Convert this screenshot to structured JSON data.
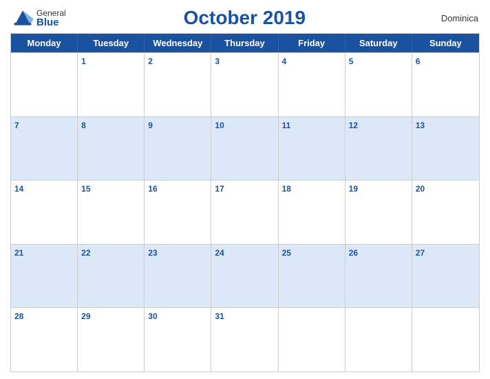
{
  "logo": {
    "general": "General",
    "blue": "Blue",
    "icon_color": "#1a52a0"
  },
  "header": {
    "title": "October 2019",
    "country": "Dominica"
  },
  "days_header": [
    "Monday",
    "Tuesday",
    "Wednesday",
    "Thursday",
    "Friday",
    "Saturday",
    "Sunday"
  ],
  "weeks": [
    [
      {
        "day": "",
        "empty": true,
        "blue": false
      },
      {
        "day": "1",
        "empty": false,
        "blue": false
      },
      {
        "day": "2",
        "empty": false,
        "blue": false
      },
      {
        "day": "3",
        "empty": false,
        "blue": false
      },
      {
        "day": "4",
        "empty": false,
        "blue": false
      },
      {
        "day": "5",
        "empty": false,
        "blue": false
      },
      {
        "day": "6",
        "empty": false,
        "blue": false
      }
    ],
    [
      {
        "day": "7",
        "empty": false,
        "blue": true
      },
      {
        "day": "8",
        "empty": false,
        "blue": true
      },
      {
        "day": "9",
        "empty": false,
        "blue": true
      },
      {
        "day": "10",
        "empty": false,
        "blue": true
      },
      {
        "day": "11",
        "empty": false,
        "blue": true
      },
      {
        "day": "12",
        "empty": false,
        "blue": true
      },
      {
        "day": "13",
        "empty": false,
        "blue": true
      }
    ],
    [
      {
        "day": "14",
        "empty": false,
        "blue": false
      },
      {
        "day": "15",
        "empty": false,
        "blue": false
      },
      {
        "day": "16",
        "empty": false,
        "blue": false
      },
      {
        "day": "17",
        "empty": false,
        "blue": false
      },
      {
        "day": "18",
        "empty": false,
        "blue": false
      },
      {
        "day": "19",
        "empty": false,
        "blue": false
      },
      {
        "day": "20",
        "empty": false,
        "blue": false
      }
    ],
    [
      {
        "day": "21",
        "empty": false,
        "blue": true
      },
      {
        "day": "22",
        "empty": false,
        "blue": true
      },
      {
        "day": "23",
        "empty": false,
        "blue": true
      },
      {
        "day": "24",
        "empty": false,
        "blue": true
      },
      {
        "day": "25",
        "empty": false,
        "blue": true
      },
      {
        "day": "26",
        "empty": false,
        "blue": true
      },
      {
        "day": "27",
        "empty": false,
        "blue": true
      }
    ],
    [
      {
        "day": "28",
        "empty": false,
        "blue": false
      },
      {
        "day": "29",
        "empty": false,
        "blue": false
      },
      {
        "day": "30",
        "empty": false,
        "blue": false
      },
      {
        "day": "31",
        "empty": false,
        "blue": false
      },
      {
        "day": "",
        "empty": true,
        "blue": false
      },
      {
        "day": "",
        "empty": true,
        "blue": false
      },
      {
        "day": "",
        "empty": true,
        "blue": false
      }
    ]
  ]
}
